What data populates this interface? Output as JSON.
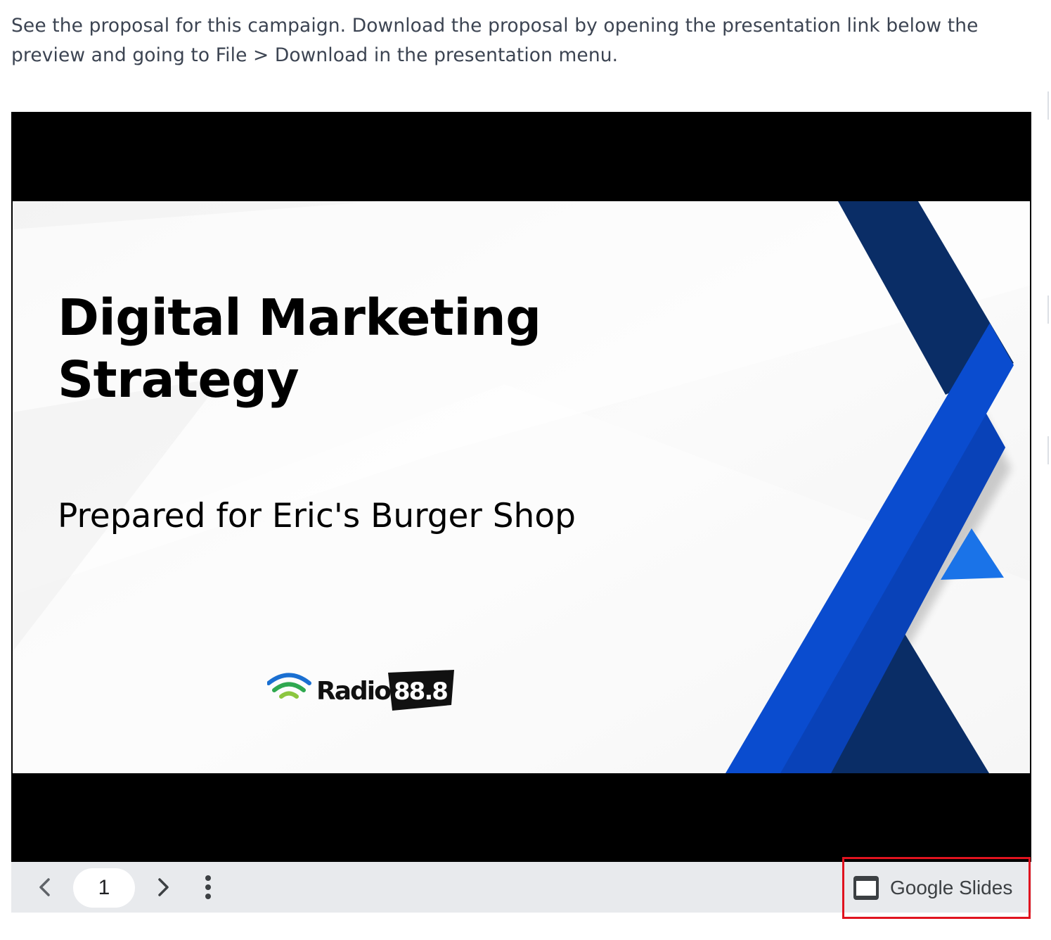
{
  "intro": {
    "text": "See the proposal for this campaign. Download the proposal by opening the presentation link below the preview and going to File > Download in the presentation menu."
  },
  "slide": {
    "title": "Digital Marketing Strategy",
    "subtitle": "Prepared for Eric's Burger Shop",
    "logo": {
      "word": "Radio",
      "number": "88.8",
      "icon": "radio-waves-icon"
    },
    "colors": {
      "navy": "#0a2d66",
      "blue": "#0a4ccf",
      "light_blue": "#1a73e8"
    }
  },
  "toolbar": {
    "page_number": "1",
    "prev_icon": "chevron-left-icon",
    "next_icon": "chevron-right-icon",
    "menu_icon": "more-vert-icon",
    "app_icon": "slides-icon",
    "app_label": "Google Slides"
  },
  "annotation": {
    "highlight_color": "#e0131f"
  }
}
